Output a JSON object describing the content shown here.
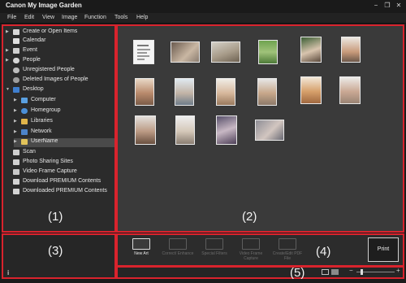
{
  "window": {
    "title": "Canon My Image Garden",
    "minimize": "−",
    "restore": "❐",
    "close": "✕"
  },
  "menu": [
    "File",
    "Edit",
    "View",
    "Image",
    "Function",
    "Tools",
    "Help"
  ],
  "sidebar": {
    "items": [
      {
        "label": "Create or Open Items",
        "arrow": "▶",
        "icon": "create-items-icon"
      },
      {
        "label": "Calendar",
        "arrow": "",
        "icon": "calendar-icon"
      },
      {
        "label": "Event",
        "arrow": "▶",
        "icon": "event-icon"
      },
      {
        "label": "People",
        "arrow": "▶",
        "icon": "people-icon"
      },
      {
        "label": "Unregistered People",
        "arrow": "",
        "icon": "unregistered-people-icon"
      },
      {
        "label": "Deleted Images of People",
        "arrow": "",
        "icon": "deleted-people-icon"
      },
      {
        "label": "Desktop",
        "arrow": "▼",
        "icon": "desktop-icon"
      },
      {
        "label": "Computer",
        "arrow": "▶",
        "icon": "computer-icon"
      },
      {
        "label": "Homegroup",
        "arrow": "▶",
        "icon": "homegroup-icon"
      },
      {
        "label": "Libraries",
        "arrow": "▶",
        "icon": "libraries-icon"
      },
      {
        "label": "Network",
        "arrow": "▶",
        "icon": "network-icon"
      },
      {
        "label": "UserName",
        "arrow": "▶",
        "icon": "user-folder-icon"
      },
      {
        "label": "Scan",
        "arrow": "",
        "icon": "scan-icon"
      },
      {
        "label": "Photo Sharing Sites",
        "arrow": "",
        "icon": "photo-sharing-icon"
      },
      {
        "label": "Video Frame Capture",
        "arrow": "",
        "icon": "video-frame-icon"
      },
      {
        "label": "Download PREMIUM Contents",
        "arrow": "",
        "icon": "download-premium-icon"
      },
      {
        "label": "Downloaded PREMIUM Contents",
        "arrow": "",
        "icon": "downloaded-premium-icon"
      }
    ],
    "info_icon": "i"
  },
  "toolbar": {
    "tools": [
      {
        "label": "New Art",
        "icon": "new-art-icon",
        "enabled": true
      },
      {
        "label": "Correct/ Enhance",
        "icon": "correct-enhance-icon",
        "enabled": false
      },
      {
        "label": "Special Filters",
        "icon": "special-filters-icon",
        "enabled": false
      },
      {
        "label": "Video Frame Capture",
        "icon": "video-capture-icon",
        "enabled": false
      },
      {
        "label": "Create/Edit PDF File",
        "icon": "pdf-icon",
        "enabled": false
      }
    ],
    "print_label": "Print"
  },
  "statusbar": {
    "zoom_minus": "−",
    "zoom_plus": "+",
    "zoom_fraction": 0.12
  },
  "regions": {
    "r1": "(1)",
    "r2": "(2)",
    "r3": "(3)",
    "r4": "(4)",
    "r5": "(5)"
  },
  "colors": {
    "annotation_red": "#d9232d"
  }
}
